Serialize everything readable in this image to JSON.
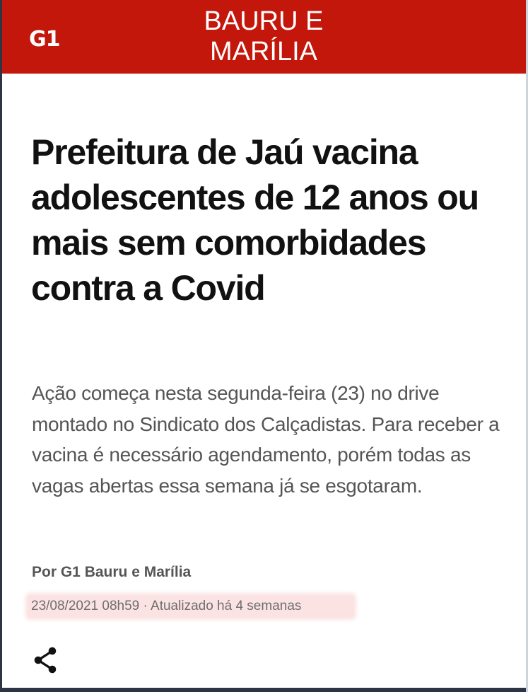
{
  "header": {
    "logo_text": "G1",
    "section_line1": "BAURU E",
    "section_line2": "MARÍLIA",
    "background_color": "#c4170c"
  },
  "article": {
    "headline": "Prefeitura de Jaú vacina adolescentes de 12 anos ou mais sem comorbidades contra a Covid",
    "subtitle": "Ação começa nesta segunda-feira (23) no drive montado no Sindicato dos Calçadistas. Para receber a vacina é necessário agendamento, porém todas as vagas abertas essa semana já se esgotaram.",
    "byline": "Por G1 Bauru e Marília",
    "timestamp": "23/08/2021 08h59 · Atualizado há 4 semanas"
  },
  "actions": {
    "share_icon": "share-icon"
  }
}
